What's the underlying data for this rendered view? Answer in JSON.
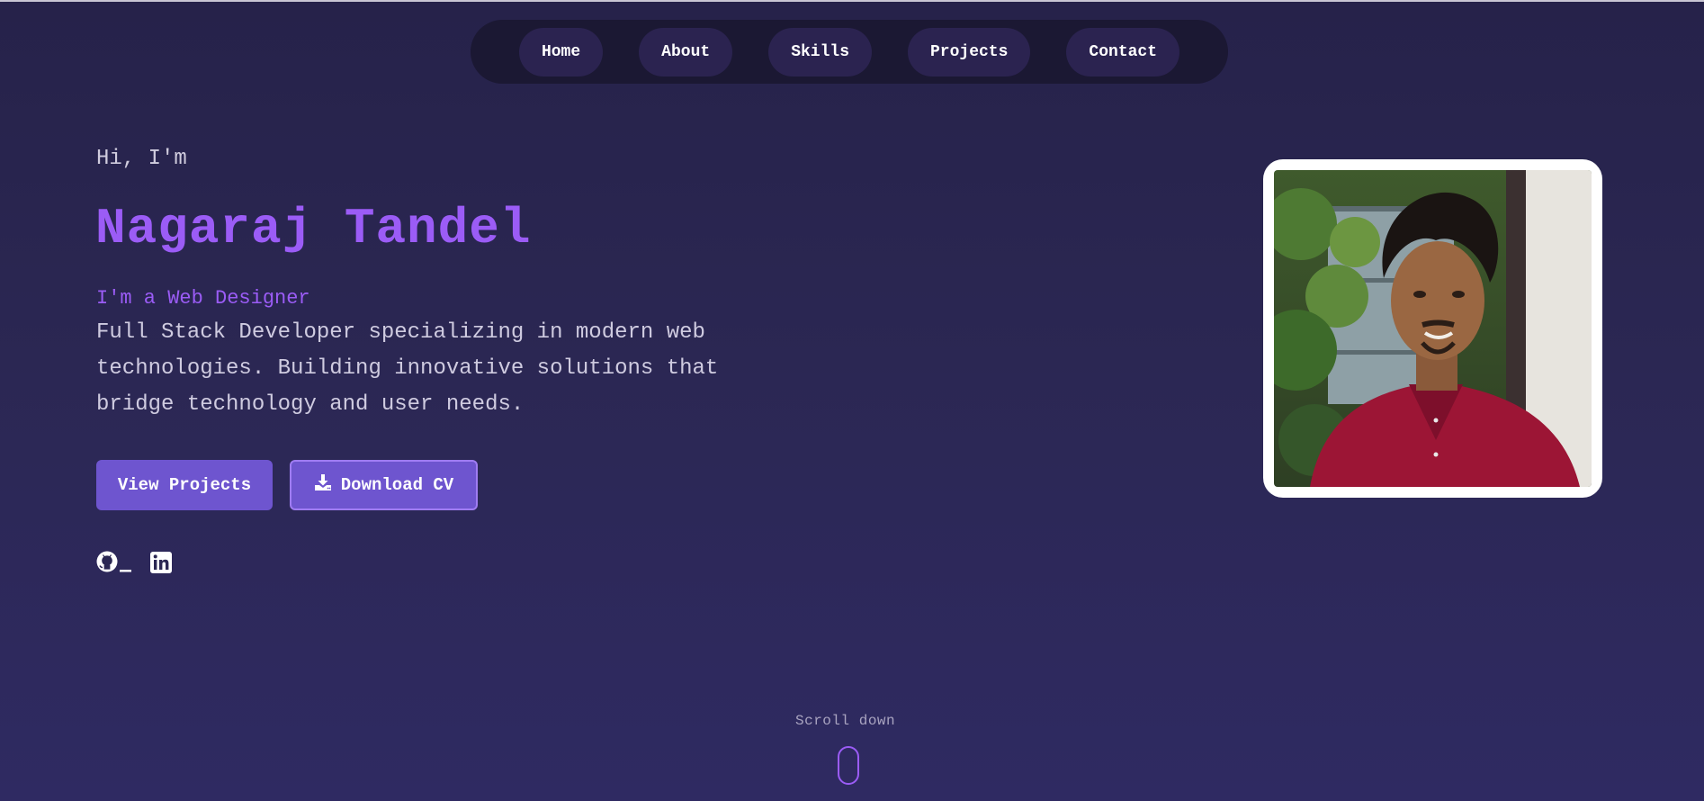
{
  "nav": {
    "items": [
      {
        "label": "Home"
      },
      {
        "label": "About"
      },
      {
        "label": "Skills"
      },
      {
        "label": "Projects"
      },
      {
        "label": "Contact"
      }
    ]
  },
  "hero": {
    "greeting": "Hi, I'm",
    "name": "Nagaraj Tandel",
    "role": "I'm a Web Designer",
    "bio": "Full Stack Developer specializing in modern web technologies. Building innovative solutions that bridge technology and user needs.",
    "primary_button": "View Projects",
    "secondary_button": "Download CV"
  },
  "socials": {
    "items": [
      {
        "icon": "github-icon"
      },
      {
        "icon": "linkedin-icon"
      }
    ]
  },
  "scroll": {
    "label": "Scroll down"
  },
  "colors": {
    "accent": "#9b5cf6",
    "button": "#6e55cf",
    "nav_bg": "#1b1833",
    "page_bg": "#2b2753"
  }
}
